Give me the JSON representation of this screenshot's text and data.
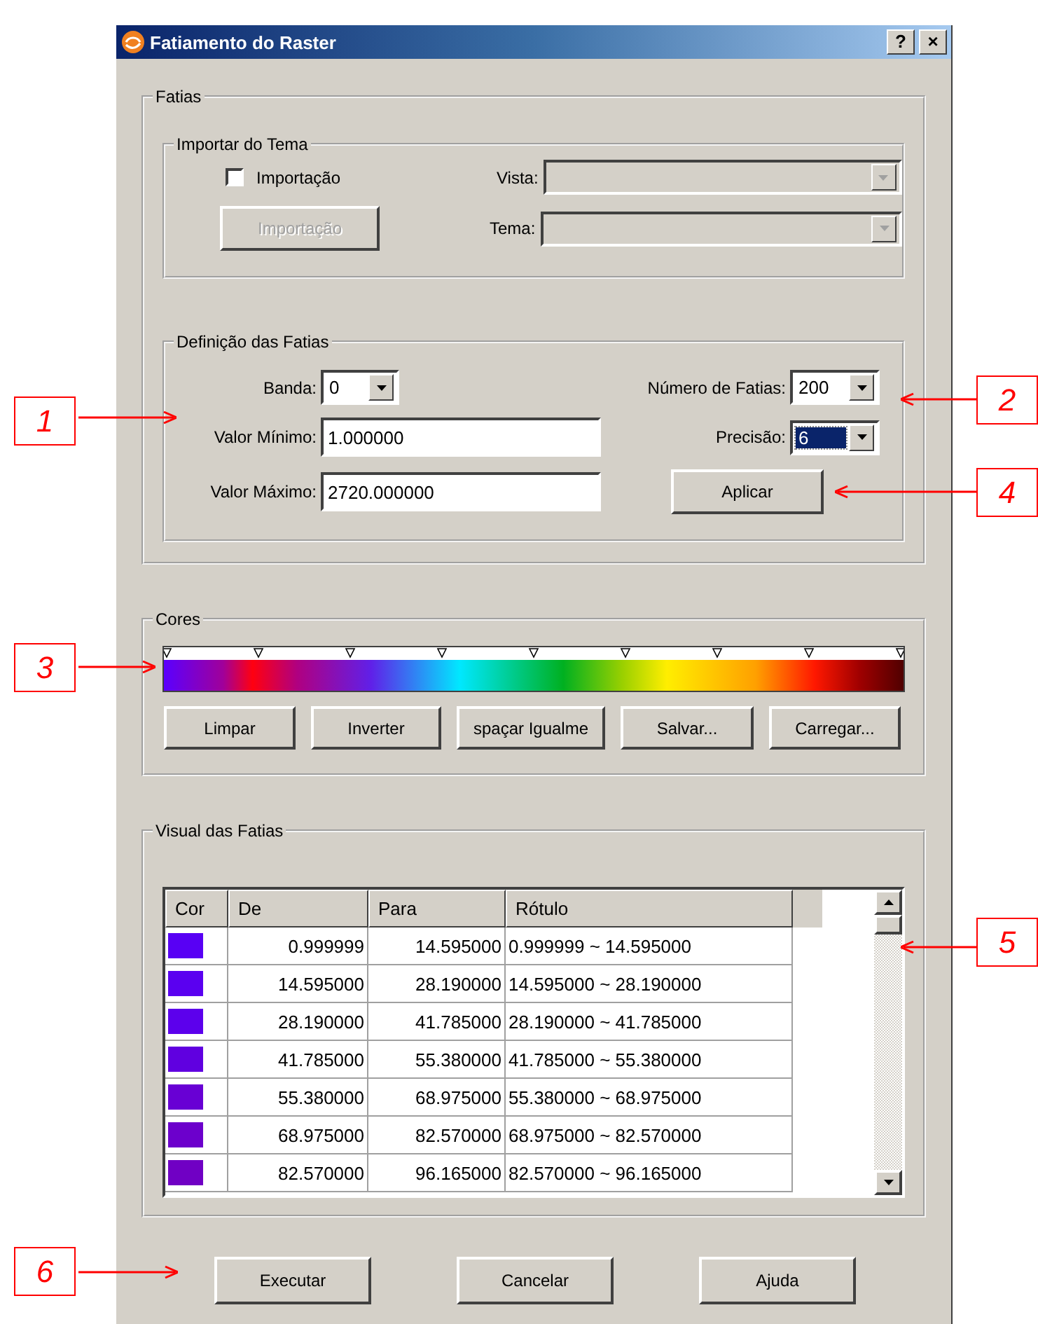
{
  "window": {
    "title": "Fatiamento do Raster",
    "buttons": [
      "?",
      "×"
    ]
  },
  "fatias": {
    "label": "Fatias",
    "importar": {
      "label": "Importar do Tema",
      "checkbox": {
        "label": "Importação",
        "checked": false
      },
      "button": {
        "label": "Importação",
        "disabled": true
      },
      "combos": [
        {
          "label": "Vista:",
          "disabled": true
        },
        {
          "label": "Tema:",
          "disabled": true
        }
      ]
    },
    "definicao": {
      "label": "Definição das Fatias",
      "banda": {
        "label": "Banda:",
        "value": "0",
        "highlighted": false
      },
      "numero": {
        "label": "Número de Fatias:",
        "value": "200",
        "highlighted": false
      },
      "minimo": {
        "label": "Valor Mínimo:",
        "value": "1.000000"
      },
      "precisao": {
        "label": "Precisão:",
        "value": "6",
        "highlighted": true
      },
      "maximo": {
        "label": "Valor Máximo:",
        "value": "2720.000000"
      },
      "apply": "Aplicar"
    }
  },
  "cores": {
    "label": "Cores",
    "buttons": [
      "Limpar",
      "Inverter",
      "spaçar Igualme",
      "Salvar...",
      "Carregar..."
    ]
  },
  "visual": {
    "label": "Visual das Fatias",
    "columns": [
      "Cor",
      "De",
      "Para",
      "Rótulo"
    ],
    "rows": [
      {
        "color": "#5800f4",
        "de": "0.999999",
        "para": "14.595000",
        "rotulo": "0.999999 ~ 14.595000"
      },
      {
        "color": "#5a00f0",
        "de": "14.595000",
        "para": "28.190000",
        "rotulo": "14.595000 ~ 28.190000"
      },
      {
        "color": "#5c00ec",
        "de": "28.190000",
        "para": "41.785000",
        "rotulo": "28.190000 ~ 41.785000"
      },
      {
        "color": "#6000e0",
        "de": "41.785000",
        "para": "55.380000",
        "rotulo": "41.785000 ~ 55.380000"
      },
      {
        "color": "#6800d4",
        "de": "55.380000",
        "para": "68.975000",
        "rotulo": "55.380000 ~ 68.975000"
      },
      {
        "color": "#6c00cc",
        "de": "68.975000",
        "para": "82.570000",
        "rotulo": "68.975000 ~ 82.570000"
      },
      {
        "color": "#7000c4",
        "de": "82.570000",
        "para": "96.165000",
        "rotulo": "82.570000 ~ 96.165000"
      }
    ]
  },
  "buttons": [
    "Executar",
    "Cancelar",
    "Ajuda"
  ],
  "callouts": [
    "1",
    "2",
    "3",
    "4",
    "5",
    "6"
  ]
}
